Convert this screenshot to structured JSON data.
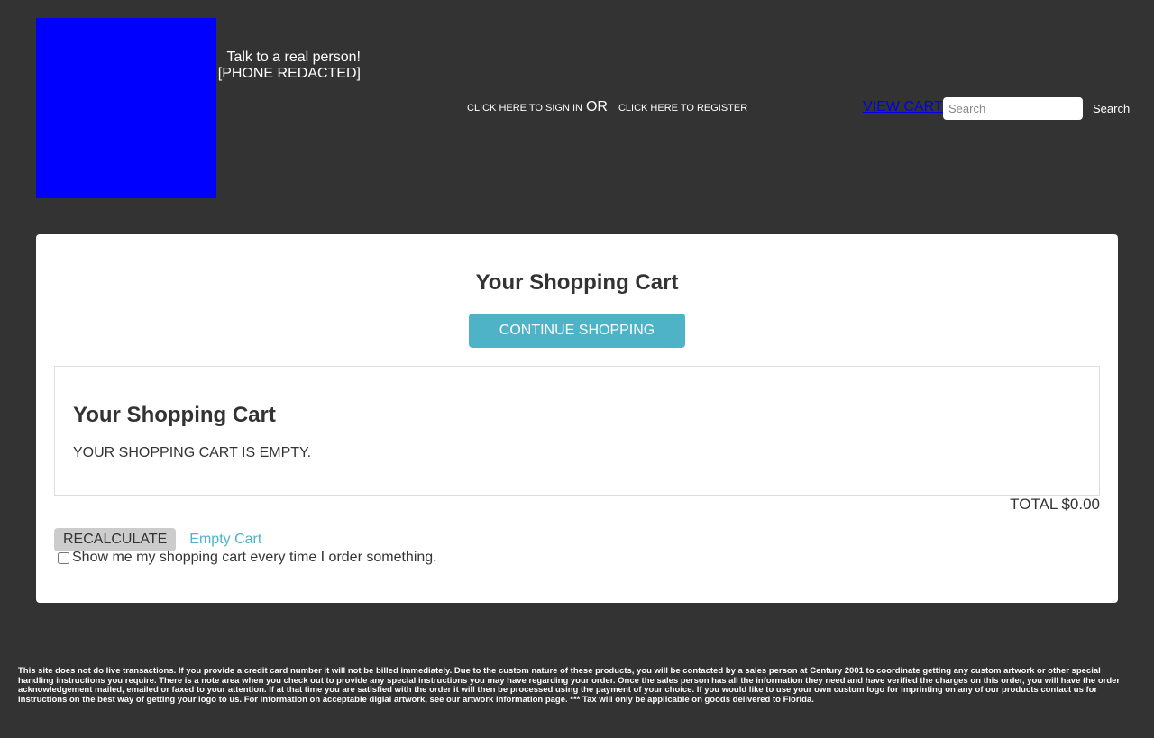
{
  "header": {
    "contact_line1": "Talk to a real person!",
    "contact_line2": "[PHONE REDACTED]",
    "sign_in": "CLICK HERE TO SIGN IN",
    "or": "OR",
    "register": "CLICK HERE TO REGISTER",
    "view_cart": "VIEW CART",
    "search_placeholder": "Search",
    "search_button": "Search"
  },
  "cart": {
    "title": "Your Shopping Cart",
    "continue_label": "CONTINUE SHOPPING",
    "inner_title": "Your Shopping Cart",
    "empty_message": "YOUR SHOPPING CART IS EMPTY.",
    "total": "TOTAL $0.00",
    "recalculate_label": "RECALCULATE",
    "empty_cart_label": "Empty Cart",
    "show_cart_label": "Show me my shopping cart every time I order something."
  },
  "footer": {
    "disclaimer": "This site does not do live transactions. If you provide a credit card number it will not be billed immediately. Due to the custom nature of these products, you will be contacted by a sales person at Century 2001 to coordinate getting any custom artwork or other special handling instructions you require. There is a note area when you check out to provide any special instructions you may have regarding your order. Once the sales person has all the information they need and have verified the charges on this order, you will have the order acknowledgement mailed, emailed or faxed to your attention. If at that time you are satisfied with the order it will then be processed using the payment of your choice. If you would like to use your own custom logo for imprinting on any of our products contact us for instructions on the best way of getting your logo to us. For information on acceptable digial artwork, see our artwork information page. *** Tax will only be applicable on goods delivered to Florida."
  },
  "colors": {
    "background": "#333333",
    "logo": "#0000ff",
    "accent": "#4eb3c7",
    "link": "#0000ee"
  }
}
